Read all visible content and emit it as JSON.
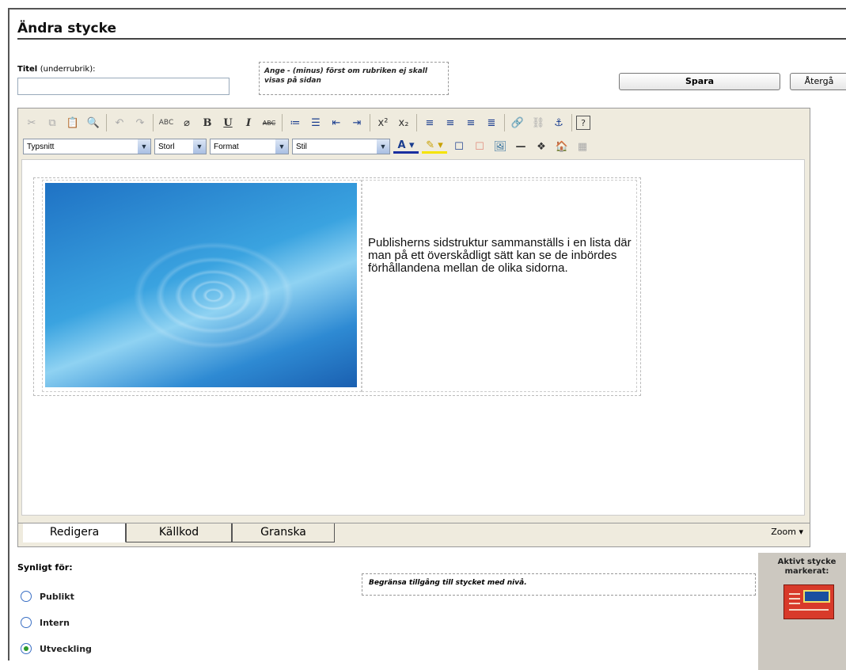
{
  "header": {
    "title": "Ändra stycke"
  },
  "title_field": {
    "label": "Titel",
    "label_sub": "(underrubrik):",
    "value": "",
    "hint": "Ange - (minus) först om rubriken ej skall visas på sidan"
  },
  "actions": {
    "save": "Spara",
    "back": "Återgå"
  },
  "toolbar": {
    "font_select": "Typsnitt",
    "size_select": "Storl",
    "format_select": "Format",
    "style_select": "Stil",
    "bold": "B",
    "underline": "U",
    "italic": "I",
    "strike": "ABC",
    "spell": "ABC"
  },
  "editor": {
    "content_text": "Publisherns sidstruktur sammanställs i en lista där man på ett överskådligt sätt kan se de inbördes förhållandena mellan de olika sidorna."
  },
  "tabs": [
    {
      "label": "Redigera",
      "active": true
    },
    {
      "label": "Källkod",
      "active": false
    },
    {
      "label": "Granska",
      "active": false
    }
  ],
  "zoom": "Zoom",
  "visibility": {
    "label": "Synligt för:",
    "options": [
      {
        "label": "Publikt",
        "checked": false
      },
      {
        "label": "Intern",
        "checked": false
      },
      {
        "label": "Utveckling",
        "checked": true
      }
    ],
    "hint": "Begränsa tillgång till stycket med nivå."
  },
  "active_panel": {
    "label": "Aktivt stycke markerat:"
  },
  "colors": {
    "editor_bg": "#efebde",
    "radio_checked": "#2a9a2a",
    "active_icon": "#d83a2a"
  }
}
